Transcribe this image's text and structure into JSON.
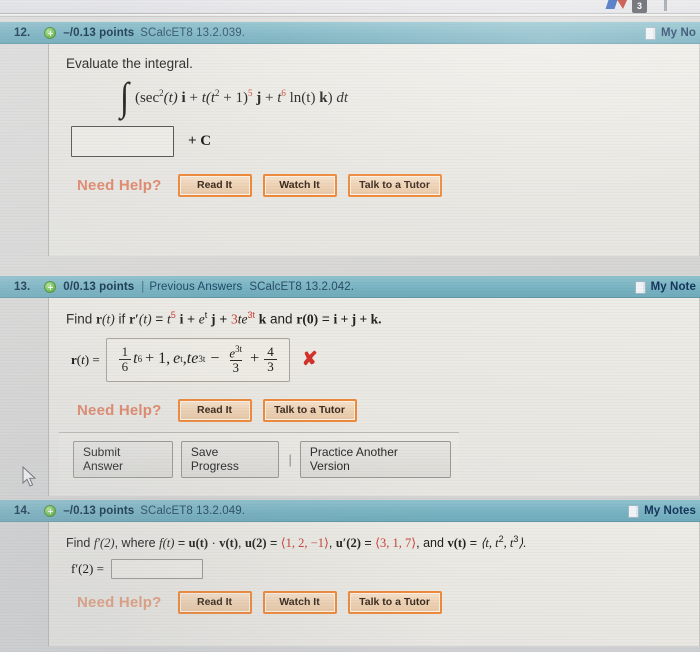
{
  "browser": {
    "badge_count": "3"
  },
  "problems": [
    {
      "number": "12.",
      "points": "–/0.13 points",
      "has_previous_answers": false,
      "previous_answers": "",
      "divider": "|",
      "code": "SCalcET8 13.2.039.",
      "my_notes": "My No",
      "prompt": "Evaluate the integral.",
      "integral": {
        "sign": "∫",
        "open_paren": "(",
        "term1_fn": "sec",
        "term1_exp": "2",
        "term1_arg": "(t)",
        "term1_vec": "i",
        "plus1": "+",
        "term2_a": "t(t",
        "term2_exp_inner": "2",
        "term2_b": " + 1)",
        "term2_exp_outer": "5",
        "term2_vec": "j",
        "plus2": "+",
        "term3_base": "t",
        "term3_exp": "6",
        "term3_ln": "ln(t)",
        "term3_vec": "k",
        "close_paren": ")",
        "differential": "dt"
      },
      "answer_value": "",
      "plus_c": "+ C",
      "need_help_label": "Need Help?",
      "help_buttons": [
        "Read It",
        "Watch It",
        "Talk to a Tutor"
      ],
      "show_action_bar": false
    },
    {
      "number": "13.",
      "points": "0/0.13 points",
      "has_previous_answers": true,
      "previous_answers": "Previous Answers",
      "divider": "|",
      "code": "SCalcET8 13.2.042.",
      "my_notes": "My Note",
      "question": {
        "find": "Find",
        "r_of_t": "r",
        "t_paren": "(t)",
        "if": "if",
        "rprime": "r′",
        "equals": "=",
        "t_base": "t",
        "t_exp": "5",
        "vec_i": "i",
        "plus1": "+",
        "e_base": "e",
        "e_exp": "t",
        "vec_j": "j",
        "plus2": "+",
        "coef3": "3",
        "te_base": "te",
        "te_exp": "3t",
        "vec_k": "k",
        "and": "and",
        "r_zero": "r(0)",
        "equals2": "=",
        "ijk": "i + j + k."
      },
      "answer_label": "r(t) =",
      "answer_expr": {
        "frac1_num": "1",
        "frac1_den": "6",
        "t_base": "t",
        "t_exp": "6",
        "plus1": "+ 1,",
        "e_base": "e",
        "e_exp": "t",
        "comma": ",",
        "te_base": "te",
        "te_exp": "3t",
        "minus": "−",
        "frac2_num_base": "e",
        "frac2_num_exp": "3t",
        "frac2_den": "3",
        "plus2": "+",
        "frac3_num": "4",
        "frac3_den": "3"
      },
      "mark": "✘",
      "mark_color": "#d1332c",
      "need_help_label": "Need Help?",
      "help_buttons": [
        "Read It",
        "Talk to a Tutor"
      ],
      "show_action_bar": true,
      "action_buttons": [
        "Submit Answer",
        "Save Progress",
        "Practice Another Version"
      ],
      "action_separator": "|"
    },
    {
      "number": "14.",
      "points": "–/0.13 points",
      "has_previous_answers": false,
      "previous_answers": "",
      "divider": "|",
      "code": "SCalcET8 13.2.049.",
      "my_notes": "My Notes",
      "question": {
        "find": "Find",
        "fprime2": "f′(2)",
        "where": ", where",
        "ft": "f(t)",
        "eq1": "=",
        "u_of_t": "u(t)",
        "dot": "·",
        "v_of_t": "v(t)",
        "comma1": ",",
        "u2": "u(2)",
        "eq2": "=",
        "u2_val": "⟨1, 2, −1⟩",
        "comma2": ",",
        "uprime2": "u′(2)",
        "eq3": "=",
        "uprime2_val": "⟨3, 1, 7⟩",
        "and": ", and",
        "vt": "v(t)",
        "eq4": "=",
        "vt_val_open": "⟨t, t",
        "vt_exp1": "2",
        "vt_mid": ", t",
        "vt_exp2": "3",
        "vt_close": "⟩."
      },
      "answer_label": "f′(2) =",
      "answer_value": "",
      "need_help_label": "Need Help?",
      "help_buttons": [
        "Read It",
        "Watch It",
        "Talk to a Tutor"
      ],
      "show_action_bar": false
    }
  ],
  "colors": {
    "header_teal": "#79b3c2",
    "help_orange": "#ef8a3c",
    "need_help_text": "#e0876b",
    "math_red": "#c9403a",
    "x_mark_red": "#d1332c",
    "panel_bg": "#eae8e2"
  }
}
